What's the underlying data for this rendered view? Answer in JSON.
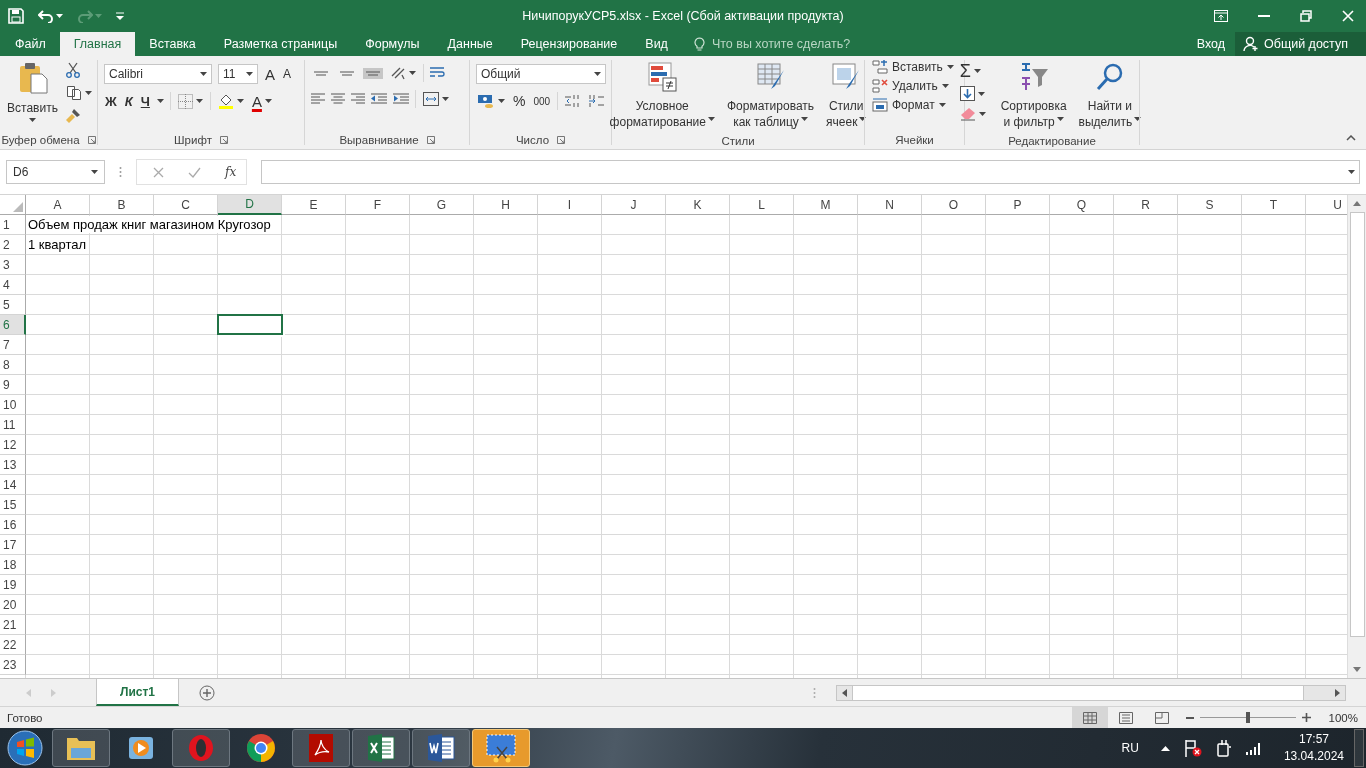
{
  "title_bar": {
    "title": "НичипорукУСР5.xlsx - Excel (Сбой активации продукта)",
    "redo_disabled": true
  },
  "tabs": [
    {
      "label": "Файл",
      "selected": false
    },
    {
      "label": "Главная",
      "selected": true
    },
    {
      "label": "Вставка",
      "selected": false
    },
    {
      "label": "Разметка страницы",
      "selected": false
    },
    {
      "label": "Формулы",
      "selected": false
    },
    {
      "label": "Данные",
      "selected": false
    },
    {
      "label": "Рецензирование",
      "selected": false
    },
    {
      "label": "Вид",
      "selected": false
    }
  ],
  "tell_me": {
    "placeholder": "Что вы хотите сделать?"
  },
  "account": {
    "sign_in": "Вход",
    "share": "Общий доступ"
  },
  "ribbon": {
    "clipboard": {
      "paste": "Вставить",
      "label": "Буфер обмена"
    },
    "font": {
      "name": "Calibri",
      "size": "11",
      "grow": "A",
      "shrink": "A",
      "bold": "Ж",
      "italic": "К",
      "underline": "Ч",
      "font_color": "A",
      "label": "Шрифт"
    },
    "alignment": {
      "vertical": [
        {
          "selected": false
        },
        {
          "selected": false
        },
        {
          "selected": true
        }
      ],
      "label": "Выравнивание"
    },
    "number": {
      "format": "Общий",
      "percent": "%",
      "thousands": "000",
      "label": "Число"
    },
    "styles": {
      "buttons": [
        {
          "line1": "Условное",
          "line2": "форматирование",
          "kind": "conditional"
        },
        {
          "line1": "Форматировать",
          "line2": "как таблицу",
          "kind": "table"
        },
        {
          "line1": "Стили",
          "line2": "ячеек",
          "kind": "cell"
        }
      ],
      "label": "Стили"
    },
    "cells": {
      "buttons": [
        {
          "label": "Вставить",
          "kind": "insert"
        },
        {
          "label": "Удалить",
          "kind": "delete"
        },
        {
          "label": "Формат",
          "kind": "format"
        }
      ],
      "label": "Ячейки"
    },
    "editing": {
      "autosum": "Σ",
      "buttons": [
        {
          "line1": "Сортировка",
          "line2": "и фильтр",
          "kind": "sort"
        },
        {
          "line1": "Найти и",
          "line2": "выделить",
          "kind": "find"
        }
      ],
      "label": "Редактирование"
    }
  },
  "formula_bar": {
    "name_box": "D6",
    "function_label": "fx"
  },
  "sheet": {
    "columns": [
      {
        "label": "A",
        "selected": false
      },
      {
        "label": "B",
        "selected": false
      },
      {
        "label": "C",
        "selected": false
      },
      {
        "label": "D",
        "selected": true
      },
      {
        "label": "E",
        "selected": false
      },
      {
        "label": "F",
        "selected": false
      },
      {
        "label": "G",
        "selected": false
      },
      {
        "label": "H",
        "selected": false
      },
      {
        "label": "I",
        "selected": false
      },
      {
        "label": "J",
        "selected": false
      },
      {
        "label": "K",
        "selected": false
      },
      {
        "label": "L",
        "selected": false
      },
      {
        "label": "M",
        "selected": false
      },
      {
        "label": "N",
        "selected": false
      },
      {
        "label": "O",
        "selected": false
      },
      {
        "label": "P",
        "selected": false
      },
      {
        "label": "Q",
        "selected": false
      },
      {
        "label": "R",
        "selected": false
      },
      {
        "label": "S",
        "selected": false
      },
      {
        "label": "T",
        "selected": false
      },
      {
        "label": "U",
        "selected": false
      }
    ],
    "rows": [
      {
        "header": "1",
        "selected": false,
        "cells": [
          "Объем продаж книг магазином Кругозор"
        ]
      },
      {
        "header": "2",
        "selected": false,
        "cells": [
          "1 квартал"
        ]
      },
      {
        "header": "3",
        "selected": false
      },
      {
        "header": "4",
        "selected": false
      },
      {
        "header": "5",
        "selected": false
      },
      {
        "header": "6",
        "selected": true
      },
      {
        "header": "7",
        "selected": false
      },
      {
        "header": "8",
        "selected": false
      },
      {
        "header": "9",
        "selected": false
      },
      {
        "header": "10",
        "selected": false
      },
      {
        "header": "11",
        "selected": false
      },
      {
        "header": "12",
        "selected": false
      },
      {
        "header": "13",
        "selected": false
      },
      {
        "header": "14",
        "selected": false
      },
      {
        "header": "15",
        "selected": false
      },
      {
        "header": "16",
        "selected": false
      },
      {
        "header": "17",
        "selected": false
      },
      {
        "header": "18",
        "selected": false
      },
      {
        "header": "19",
        "selected": false
      },
      {
        "header": "20",
        "selected": false
      },
      {
        "header": "21",
        "selected": false
      },
      {
        "header": "22",
        "selected": false
      },
      {
        "header": "23",
        "selected": false
      }
    ]
  },
  "sheet_tabs": [
    {
      "label": "Лист1",
      "selected": true
    }
  ],
  "status_bar": {
    "status": "Готово",
    "views": [
      {
        "kind": "normal",
        "selected": true
      },
      {
        "kind": "page_layout",
        "selected": false
      },
      {
        "kind": "page_break",
        "selected": false
      }
    ],
    "zoom": {
      "level": 0.5,
      "reading": "100%"
    }
  },
  "taskbar": {
    "apps": [
      {
        "kind": "explorer",
        "open": true,
        "selected": false
      },
      {
        "kind": "media",
        "open": false,
        "selected": false
      },
      {
        "kind": "opera",
        "open": true,
        "selected": false
      },
      {
        "kind": "chrome",
        "open": false,
        "selected": false
      },
      {
        "kind": "pdf",
        "open": true,
        "selected": false
      },
      {
        "kind": "excel",
        "open": true,
        "selected": false
      },
      {
        "kind": "word",
        "open": true,
        "selected": false
      },
      {
        "kind": "snipping",
        "open": true,
        "selected": true
      }
    ],
    "tray": {
      "language": "RU",
      "time": "17:57",
      "date": "13.04.2024"
    }
  }
}
